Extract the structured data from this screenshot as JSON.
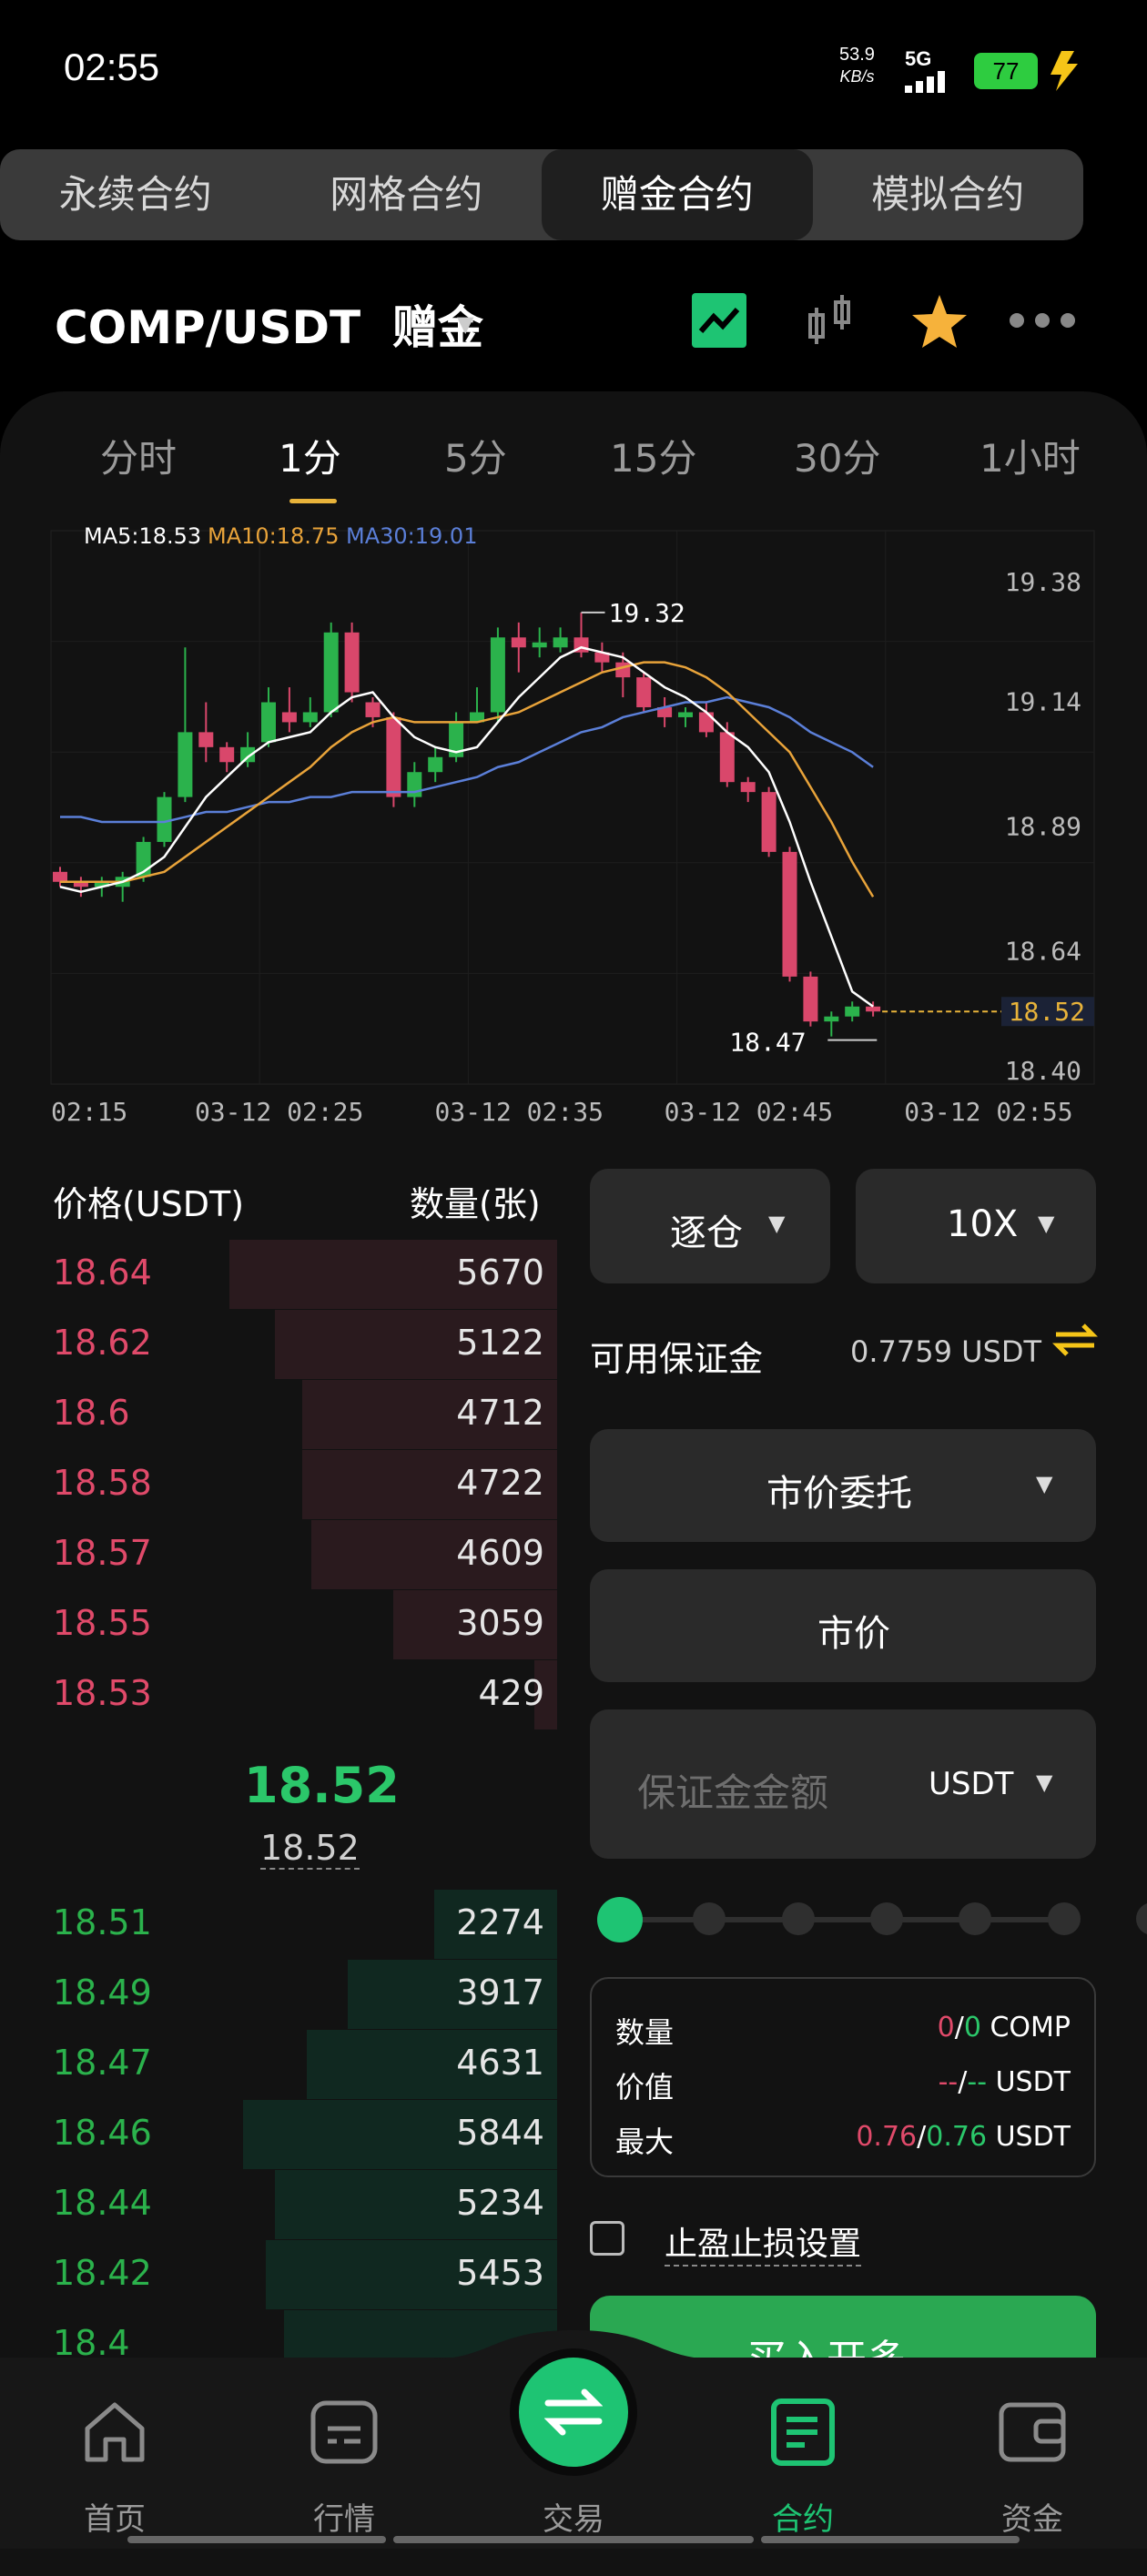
{
  "status_bar": {
    "time": "02:55",
    "net_speed_value": "53.9",
    "net_speed_unit": "KB/s",
    "network": "5G",
    "battery": "77"
  },
  "contract_tabs": [
    "永续合约",
    "网格合约",
    "赠金合约",
    "模拟合约"
  ],
  "pair": {
    "title": "COMP/USDT  赠金"
  },
  "time_tabs": [
    "分时",
    "1分",
    "5分",
    "15分",
    "30分",
    "1小时"
  ],
  "chart_data": {
    "type": "candlestick",
    "ma_labels": [
      "MA5:18.53",
      "MA10:18.75",
      "MA30:19.01"
    ],
    "colors": {
      "ma5": "#ffffff",
      "ma10": "#e8a33a",
      "ma30": "#5b7fd8",
      "up": "#2bb24c",
      "down": "#d9476b"
    },
    "y_ticks": [
      "19.38",
      "19.14",
      "18.89",
      "18.64",
      "18.40"
    ],
    "ylim": [
      18.4,
      19.38
    ],
    "x_ticks": [
      "02:15",
      "03-12 02:25",
      "03-12 02:35",
      "03-12 02:45",
      "03-12 02:55"
    ],
    "high_label": "19.32",
    "low_label": "18.47",
    "last_price": "18.52",
    "candles": [
      [
        18.8,
        18.78,
        18.81,
        18.77
      ],
      [
        18.78,
        18.77,
        18.79,
        18.75
      ],
      [
        18.77,
        18.78,
        18.79,
        18.75
      ],
      [
        18.77,
        18.79,
        18.8,
        18.74
      ],
      [
        18.79,
        18.86,
        18.87,
        18.78
      ],
      [
        18.86,
        18.95,
        18.96,
        18.85
      ],
      [
        18.95,
        19.08,
        19.25,
        18.94
      ],
      [
        19.08,
        19.05,
        19.14,
        19.02
      ],
      [
        19.05,
        19.02,
        19.06,
        19.0
      ],
      [
        19.02,
        19.05,
        19.08,
        19.01
      ],
      [
        19.06,
        19.14,
        19.17,
        19.05
      ],
      [
        19.12,
        19.1,
        19.17,
        19.08
      ],
      [
        19.1,
        19.12,
        19.15,
        19.09
      ],
      [
        19.12,
        19.28,
        19.3,
        19.11
      ],
      [
        19.28,
        19.16,
        19.3,
        19.14
      ],
      [
        19.14,
        19.11,
        19.15,
        19.09
      ],
      [
        19.11,
        18.95,
        19.12,
        18.93
      ],
      [
        18.95,
        19.0,
        19.02,
        18.93
      ],
      [
        19.0,
        19.03,
        19.05,
        18.98
      ],
      [
        19.03,
        19.1,
        19.12,
        19.02
      ],
      [
        19.1,
        19.12,
        19.17,
        19.1
      ],
      [
        19.12,
        19.27,
        19.29,
        19.1
      ],
      [
        19.27,
        19.25,
        19.3,
        19.2
      ],
      [
        19.25,
        19.26,
        19.29,
        19.23
      ],
      [
        19.25,
        19.27,
        19.29,
        19.24
      ],
      [
        19.27,
        19.24,
        19.32,
        19.23
      ],
      [
        19.24,
        19.22,
        19.26,
        19.2
      ],
      [
        19.22,
        19.19,
        19.24,
        19.15
      ],
      [
        19.19,
        19.13,
        19.2,
        19.12
      ],
      [
        19.13,
        19.11,
        19.15,
        19.09
      ],
      [
        19.11,
        19.12,
        19.13,
        19.09
      ],
      [
        19.12,
        19.08,
        19.14,
        19.07
      ],
      [
        19.08,
        18.98,
        19.1,
        18.97
      ],
      [
        18.98,
        18.96,
        18.99,
        18.94
      ],
      [
        18.96,
        18.84,
        18.97,
        18.83
      ],
      [
        18.84,
        18.59,
        18.85,
        18.58
      ],
      [
        18.59,
        18.5,
        18.6,
        18.49
      ],
      [
        18.5,
        18.51,
        18.52,
        18.47
      ],
      [
        18.51,
        18.53,
        18.54,
        18.5
      ],
      [
        18.53,
        18.52,
        18.54,
        18.51
      ]
    ],
    "ma5": [
      18.77,
      18.76,
      18.77,
      18.78,
      18.8,
      18.83,
      18.89,
      18.95,
      18.99,
      19.03,
      19.06,
      19.07,
      19.08,
      19.12,
      19.15,
      19.16,
      19.11,
      19.07,
      19.05,
      19.04,
      19.05,
      19.1,
      19.15,
      19.19,
      19.23,
      19.25,
      19.24,
      19.23,
      19.2,
      19.17,
      19.15,
      19.12,
      19.08,
      19.05,
      19.0,
      18.9,
      18.78,
      18.67,
      18.56,
      18.53
    ],
    "ma10": [
      18.78,
      18.78,
      18.78,
      18.78,
      18.79,
      18.8,
      18.83,
      18.86,
      18.89,
      18.92,
      18.95,
      18.98,
      19.01,
      19.05,
      19.08,
      19.1,
      19.11,
      19.1,
      19.1,
      19.1,
      19.1,
      19.11,
      19.12,
      19.14,
      19.16,
      19.18,
      19.2,
      19.21,
      19.22,
      19.22,
      19.21,
      19.19,
      19.16,
      19.12,
      19.08,
      19.04,
      18.97,
      18.9,
      18.82,
      18.75
    ],
    "ma30": [
      18.91,
      18.91,
      18.9,
      18.9,
      18.9,
      18.9,
      18.91,
      18.92,
      18.92,
      18.93,
      18.94,
      18.94,
      18.95,
      18.95,
      18.96,
      18.96,
      18.96,
      18.96,
      18.97,
      18.98,
      18.99,
      19.01,
      19.02,
      19.04,
      19.06,
      19.08,
      19.09,
      19.11,
      19.12,
      19.13,
      19.14,
      19.14,
      19.15,
      19.14,
      19.13,
      19.11,
      19.08,
      19.06,
      19.04,
      19.01
    ]
  },
  "orderbook": {
    "header_price": "价格(USDT)",
    "header_qty": "数量(张)",
    "asks": [
      {
        "price": "18.64",
        "qty": "5670",
        "depth": 0.72
      },
      {
        "price": "18.62",
        "qty": "5122",
        "depth": 0.62
      },
      {
        "price": "18.6",
        "qty": "4712",
        "depth": 0.56
      },
      {
        "price": "18.58",
        "qty": "4722",
        "depth": 0.56
      },
      {
        "price": "18.57",
        "qty": "4609",
        "depth": 0.54
      },
      {
        "price": "18.55",
        "qty": "3059",
        "depth": 0.36
      },
      {
        "price": "18.53",
        "qty": "429",
        "depth": 0.05
      }
    ],
    "mid_price": "18.52",
    "mark_price": "18.52",
    "bids": [
      {
        "price": "18.51",
        "qty": "2274",
        "depth": 0.27
      },
      {
        "price": "18.49",
        "qty": "3917",
        "depth": 0.46
      },
      {
        "price": "18.47",
        "qty": "4631",
        "depth": 0.55
      },
      {
        "price": "18.46",
        "qty": "5844",
        "depth": 0.69
      },
      {
        "price": "18.44",
        "qty": "5234",
        "depth": 0.62
      },
      {
        "price": "18.42",
        "qty": "5453",
        "depth": 0.64
      },
      {
        "price": "18.4",
        "qty": "",
        "depth": 0.6
      }
    ]
  },
  "order_panel": {
    "margin_mode": "逐仓",
    "leverage": "10X",
    "available_label": "可用保证金",
    "available_value": "0.7759 USDT",
    "order_type": "市价委托",
    "price_field": "市价",
    "amount_placeholder": "保证金金额",
    "amount_unit": "USDT",
    "percent_steps": 7,
    "summary": {
      "qty_label": "数量",
      "qty_a": "0",
      "qty_sep": "/",
      "qty_b": "0",
      "qty_unit": " COMP",
      "value_label": "价值",
      "value_a": "--",
      "value_sep": "/",
      "value_b": "--",
      "value_unit": " USDT",
      "max_label": "最大",
      "max_a": "0.76",
      "max_sep": "/",
      "max_b": "0.76",
      "max_unit": " USDT"
    },
    "tp_sl_label": "止盈止损设置",
    "buy_label": "买入开多"
  },
  "bottom_nav": [
    "首页",
    "行情",
    "交易",
    "合约",
    "资金"
  ]
}
